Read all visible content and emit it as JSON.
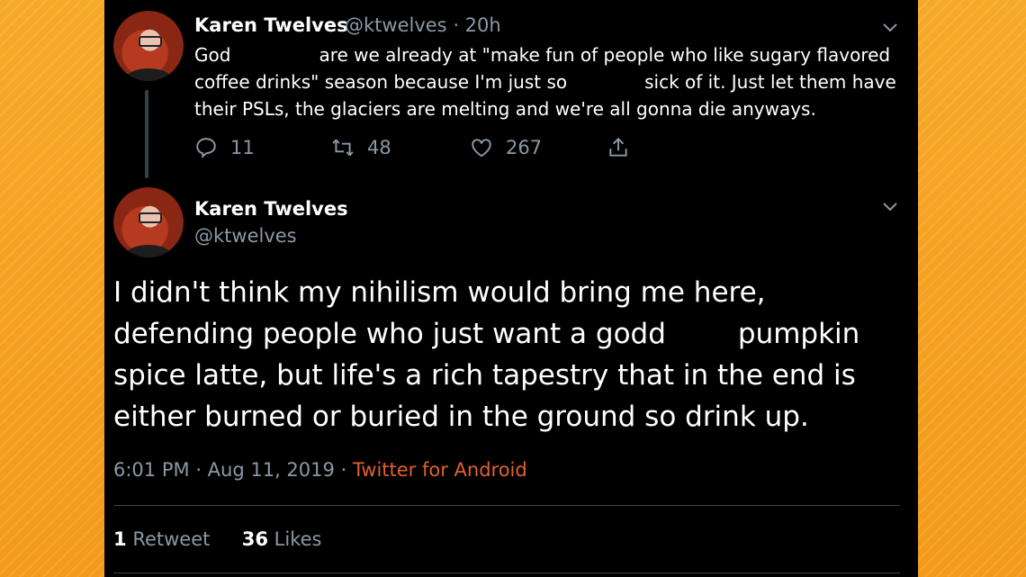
{
  "reply_tweet": {
    "display_name": "Karen Twelves",
    "handle": "@ktwelves",
    "time": "20h",
    "lines": [
      [
        "God",
        "are we already at \"make fun of people who like sugary flavored"
      ],
      [
        "coffee drinks\" season because I'm just so",
        "sick of it. Just let them have"
      ],
      [
        "their PSLs, the glaciers are melting and we're all gonna die anyways."
      ]
    ],
    "actions": {
      "replies": "11",
      "retweets": "48",
      "likes": "267"
    },
    "icons": [
      "reply-icon",
      "retweet-icon",
      "like-icon",
      "share-icon",
      "chevron-down-icon"
    ]
  },
  "main_tweet": {
    "display_name": "Karen Twelves",
    "handle": "@ktwelves",
    "lines": [
      [
        "I didn't think my nihilism would bring me here,"
      ],
      [
        "defending people who just want a godd",
        "pumpkin"
      ],
      [
        "spice latte, but life's a rich tapestry that in the end is"
      ],
      [
        "either burned or buried in the ground so drink up."
      ]
    ],
    "time": "6:01 PM",
    "date": "Aug 11, 2019",
    "source": "Twitter for Android",
    "retweet_count": "1",
    "retweet_label": "Retweet",
    "like_count": "36",
    "like_label": "Likes"
  },
  "colors": {
    "background": "#f6a623",
    "panel": "#000000",
    "text": "#ffffff",
    "muted": "#8b98a5",
    "source_link": "#e0602f",
    "divider": "#38444d"
  }
}
